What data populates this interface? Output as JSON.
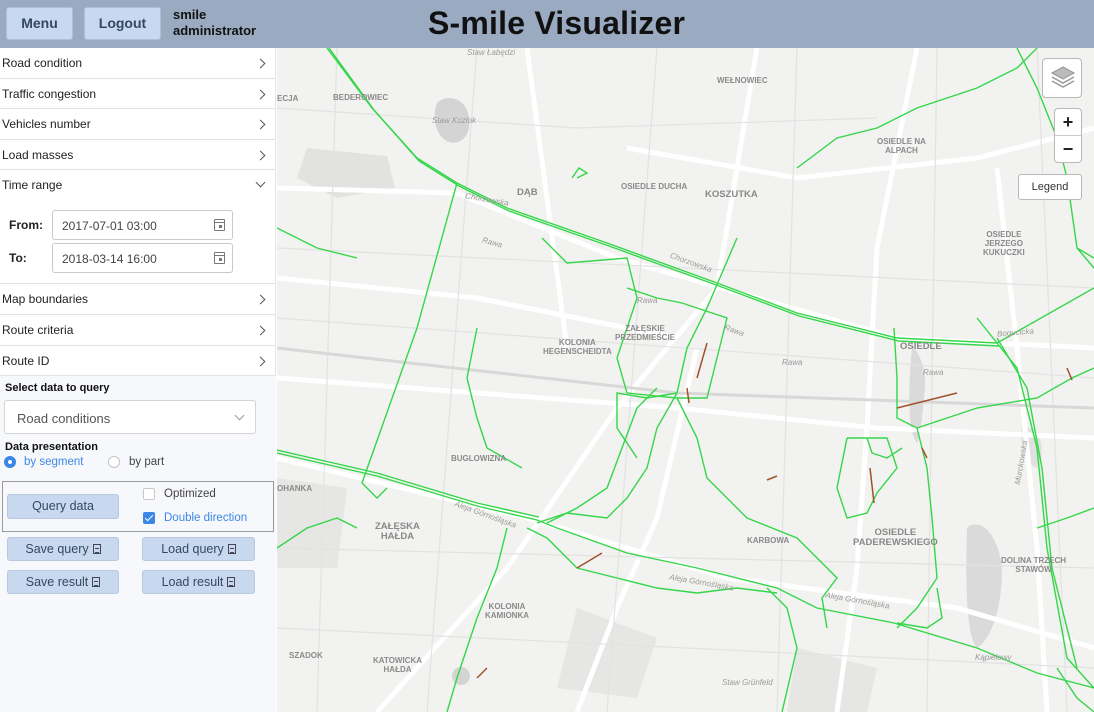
{
  "header": {
    "menu_label": "Menu",
    "logout_label": "Logout",
    "user_name": "smile",
    "user_role": "administrator",
    "app_title": "S-mile Visualizer"
  },
  "sidebar": {
    "sections": [
      {
        "label": "Road condition",
        "expanded": false
      },
      {
        "label": "Traffic congestion",
        "expanded": false
      },
      {
        "label": "Vehicles number",
        "expanded": false
      },
      {
        "label": "Load masses",
        "expanded": false
      },
      {
        "label": "Time range",
        "expanded": true
      },
      {
        "label": "Map boundaries",
        "expanded": false
      },
      {
        "label": "Route criteria",
        "expanded": false
      },
      {
        "label": "Route ID",
        "expanded": false
      }
    ],
    "time_range": {
      "from_label": "From:",
      "from_value": "2017-07-01 03:00",
      "to_label": "To:",
      "to_value": "2018-03-14 16:00"
    },
    "query": {
      "select_title": "Select data to query",
      "select_value": "Road conditions",
      "presentation_title": "Data presentation",
      "by_segment_label": "by segment",
      "by_segment_selected": true,
      "by_part_label": "by part",
      "by_part_selected": false,
      "query_button": "Query data",
      "optimized_label": "Optimized",
      "optimized_checked": false,
      "double_direction_label": "Double direction",
      "double_direction_checked": true,
      "save_query": "Save query",
      "load_query": "Load query",
      "save_result": "Save result",
      "load_result": "Load result"
    }
  },
  "map": {
    "legend_button": "Legend",
    "zoom_in": "+",
    "zoom_out": "−",
    "route_color": "#35d64a",
    "problem_color": "#a0522d",
    "labels": {
      "welnowiec": "WEŁNOWIEC",
      "bederowiec": "BEDEROWIEC",
      "ecja": "ECJA",
      "staw_lebedzi": "Staw Łabędzi",
      "staw_kozlok": "Staw Kozłok",
      "osiedle_na_alpach": "OSIEDLE NA\nALPACH",
      "dab": "DĄB",
      "osiedle_ducha": "OSIEDLE DUCHA",
      "koszutka": "KOSZUTKA",
      "osiedle_jerzego": "OSIEDLE\nJERZEGO\nKUKUCZKI",
      "zaleskie": "ZAŁĘSKIE\nPRZEDMIEŚCIE",
      "kolonia_hegen": "KOLONIA\nHEGENSCHEIDTA",
      "osiedle_cut": "OSIEDLE",
      "buglowizna": "BUGLOWIZNA",
      "ohanka": "OHANKA",
      "zaleska_halda": "ZAŁĘSKA\nHAŁDA",
      "karbowa": "KARBOWA",
      "osiedle_paderewskiego": "OSIEDLE\nPADEREWSKIEGO",
      "dolina_trzech": "DOLINA TRZECH\nSTAWÓW",
      "kolonia_kamionka": "KOLONIA\nKAMIONKA",
      "szadok": "SZADOK",
      "katowicka_halda": "KATOWICKA\nHAŁDA",
      "staw_grunfeld": "Staw Grünfeld",
      "kopalniany": "Kąpielowy",
      "rawa1": "Rawa",
      "rawa2": "Rawa",
      "rawa3": "Rawa",
      "rawa4": "Rawa",
      "rawa5": "Rawa",
      "aleja1": "Aleja Górnośląska",
      "aleja2": "Aleja Górnośląska",
      "aleja3": "Aleja Górnośląska",
      "chorzowska": "Chorzowska",
      "chorzowska2": "Chorzowska",
      "bogucicka": "Bogucicka",
      "mickiewicza": "Murckowska"
    }
  }
}
